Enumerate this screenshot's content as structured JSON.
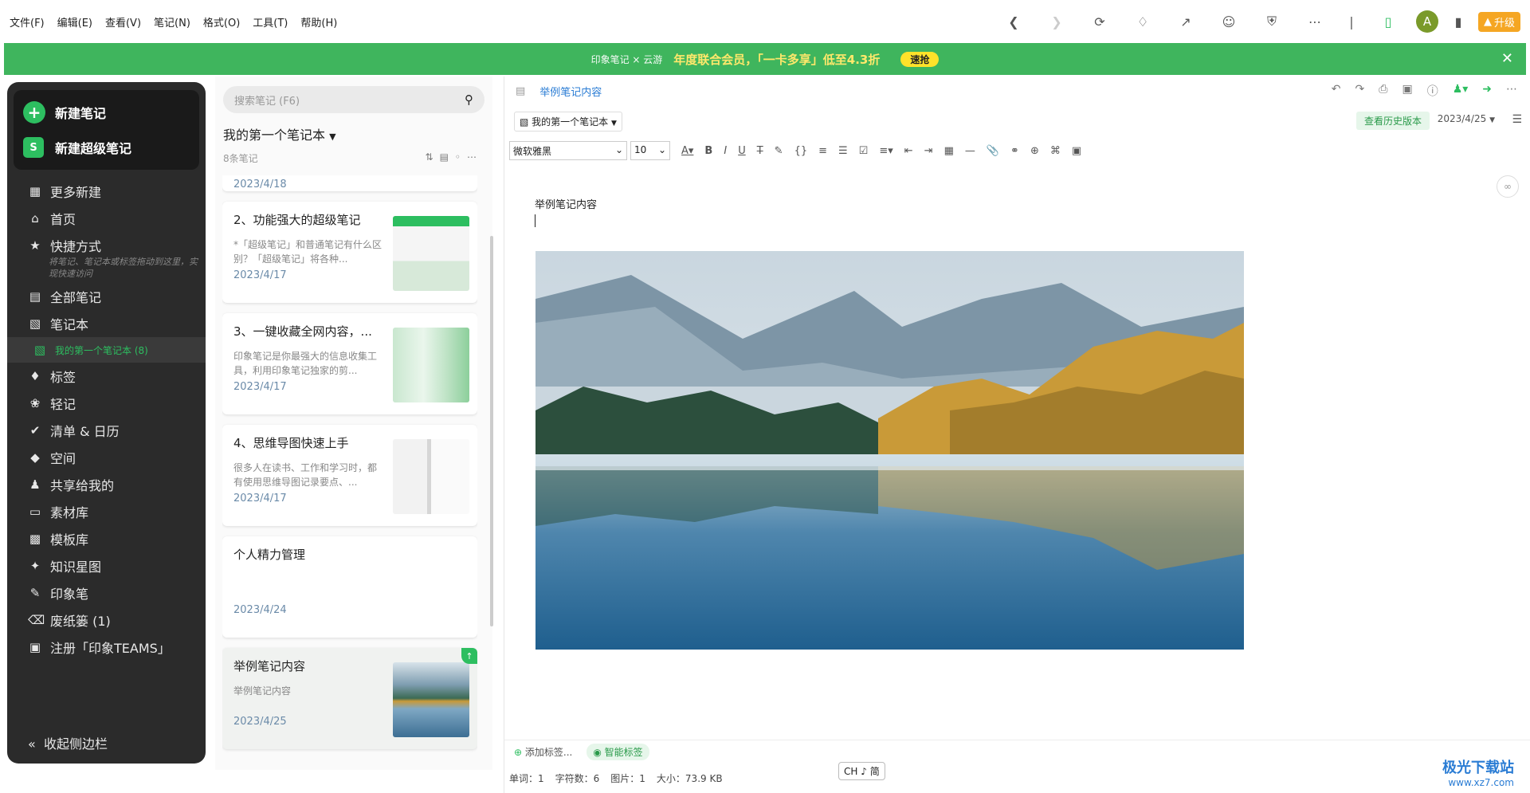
{
  "menu": [
    "文件(F)",
    "编辑(E)",
    "查看(V)",
    "笔记(N)",
    "格式(O)",
    "工具(T)",
    "帮助(H)"
  ],
  "topbar": {
    "avatar_letter": "A",
    "upgrade_label": "升级"
  },
  "banner": {
    "logo": "印象笔记 × 云游",
    "text": "年度联合会员，「一卡多享」低至4.3折",
    "button": "速抢"
  },
  "sidebar": {
    "new_note": "新建笔记",
    "new_super_note": "新建超级笔记",
    "items": [
      {
        "label": "更多新建",
        "icon": "grid-icon"
      },
      {
        "label": "首页",
        "icon": "home-icon"
      },
      {
        "label": "快捷方式",
        "icon": "star-icon"
      },
      {
        "label": "全部笔记",
        "icon": "note-icon"
      },
      {
        "label": "笔记本",
        "icon": "notebook-icon"
      },
      {
        "label": "我的第一个笔记本 (8)",
        "icon": "notebook-icon"
      },
      {
        "label": "标签",
        "icon": "tag-icon"
      },
      {
        "label": "轻记",
        "icon": "leaf-icon"
      },
      {
        "label": "清单 & 日历",
        "icon": "check-icon"
      },
      {
        "label": "空间",
        "icon": "cube-icon"
      },
      {
        "label": "共享给我的",
        "icon": "people-icon"
      },
      {
        "label": "素材库",
        "icon": "box-icon"
      },
      {
        "label": "模板库",
        "icon": "template-icon"
      },
      {
        "label": "知识星图",
        "icon": "graph-icon"
      },
      {
        "label": "印象笔",
        "icon": "pen-icon"
      },
      {
        "label": "废纸篓 (1)",
        "icon": "trash-icon"
      },
      {
        "label": "注册「印象TEAMS」",
        "icon": "building-icon"
      }
    ],
    "shortcut_hint": "将笔记、笔记本或标签拖动到这里，实现快速访问",
    "collapse": "收起侧边栏"
  },
  "notelist": {
    "search_placeholder": "搜索笔记 (F6)",
    "notebook_title": "我的第一个笔记本",
    "count": "8条笔记",
    "cards": [
      {
        "title": "",
        "snippet": "",
        "date": "2023/4/18"
      },
      {
        "title": "2、功能强大的超级笔记",
        "snippet": "*「超级笔记」和普通笔记有什么区别？「超级笔记」将各种...",
        "date": "2023/4/17"
      },
      {
        "title": "3、一键收藏全网内容，...",
        "snippet": "印象笔记是你最强大的信息收集工具，利用印象笔记独家的剪...",
        "date": "2023/4/17"
      },
      {
        "title": "4、思维导图快速上手",
        "snippet": "很多人在读书、工作和学习时，都有使用思维导图记录要点、...",
        "date": "2023/4/17"
      },
      {
        "title": "个人精力管理",
        "snippet": "",
        "date": "2023/4/24"
      },
      {
        "title": "举例笔记内容",
        "snippet": "举例笔记内容",
        "date": "2023/4/25"
      }
    ]
  },
  "editor": {
    "title": "举例笔记内容",
    "notebook": "我的第一个笔记本",
    "history_btn": "查看历史版本",
    "date": "2023/4/25",
    "font": "微软雅黑",
    "size": "10",
    "body_text": "举例笔记内容",
    "add_tag": "添加标签...",
    "smart_tag": "智能标签",
    "status": {
      "words": "单词：1",
      "chars": "字符数：6",
      "images": "图片：1",
      "size": "大小：73.9 KB"
    },
    "ime": "CH ♪ 简"
  },
  "watermark": {
    "name": "极光下载站",
    "url": "www.xz7.com"
  }
}
